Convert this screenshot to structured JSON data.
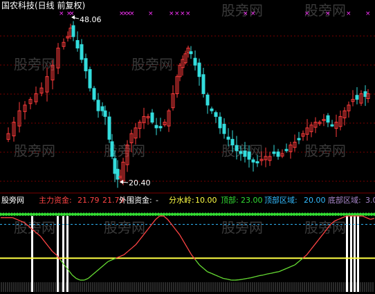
{
  "header": {
    "title": "国农科技(日线 前复权)"
  },
  "watermark": "股旁网",
  "price_panel": {
    "high_label": "48.06",
    "low_label": "20.40",
    "high_value": 48.06,
    "low_value": 20.4,
    "colors": {
      "up": "#ff3b3b",
      "down": "#33dddd",
      "marker": "#ff33ff"
    }
  },
  "indicator_header": {
    "main_funds_label": "主力资金:",
    "main_funds_value": "21.79",
    "main_funds_value2": "21.79",
    "outer_funds_label": "外围资金:",
    "outer_funds_value": "-",
    "watershed_label": "分水岭:",
    "watershed_value": "10.00",
    "top_label": "顶部:",
    "top_value": "23.00",
    "top_zone_label": "顶部区域:",
    "top_zone_value": "20.00",
    "bottom_zone_label": "底部区域:",
    "bottom_zone_value": "3.0"
  },
  "indicator_colors": {
    "main": "#ff4444",
    "outer": "#66dd33",
    "watershed": "#ffff44",
    "top": "#33dd33",
    "top_zone": "#33bbff",
    "bottom_zone": "#aa88cc"
  },
  "chart_data": {
    "type": "line",
    "title": "",
    "series": [
      {
        "name": "主力资金",
        "values": [
          22,
          22,
          22,
          22,
          21.5,
          21,
          20.5,
          19.5,
          18.5,
          17.5,
          16.5,
          15,
          13.5,
          12,
          11,
          9.5,
          8,
          6.5,
          5,
          4,
          3.5,
          3.5,
          4,
          5,
          6,
          7,
          8,
          9,
          9.5,
          10,
          10.5,
          11,
          12,
          13,
          14,
          15.5,
          17,
          18.5,
          20,
          21.5,
          22.5,
          22.5,
          21.5,
          20,
          18.5,
          17,
          15,
          13,
          11,
          9.5,
          8,
          7,
          6,
          5.5,
          5,
          4.5,
          4,
          3.8,
          3.5,
          3.5,
          3.6,
          3.8,
          4,
          4.2,
          4.5,
          4.8,
          5,
          5.3,
          5.5,
          5.8,
          6,
          6.5,
          7,
          7.5,
          8,
          9,
          10,
          11,
          12.5,
          14,
          15.5,
          17,
          18.5,
          20,
          21,
          21.5,
          22,
          22.5,
          22.5,
          22.5,
          22.5,
          22.5,
          22,
          21.5,
          21.8
        ]
      },
      {
        "name": "顶部",
        "values": [
          23
        ]
      },
      {
        "name": "顶部区域",
        "values": [
          20
        ]
      },
      {
        "name": "分水岭",
        "values": [
          10
        ]
      }
    ],
    "ylim": [
      0,
      25
    ]
  }
}
